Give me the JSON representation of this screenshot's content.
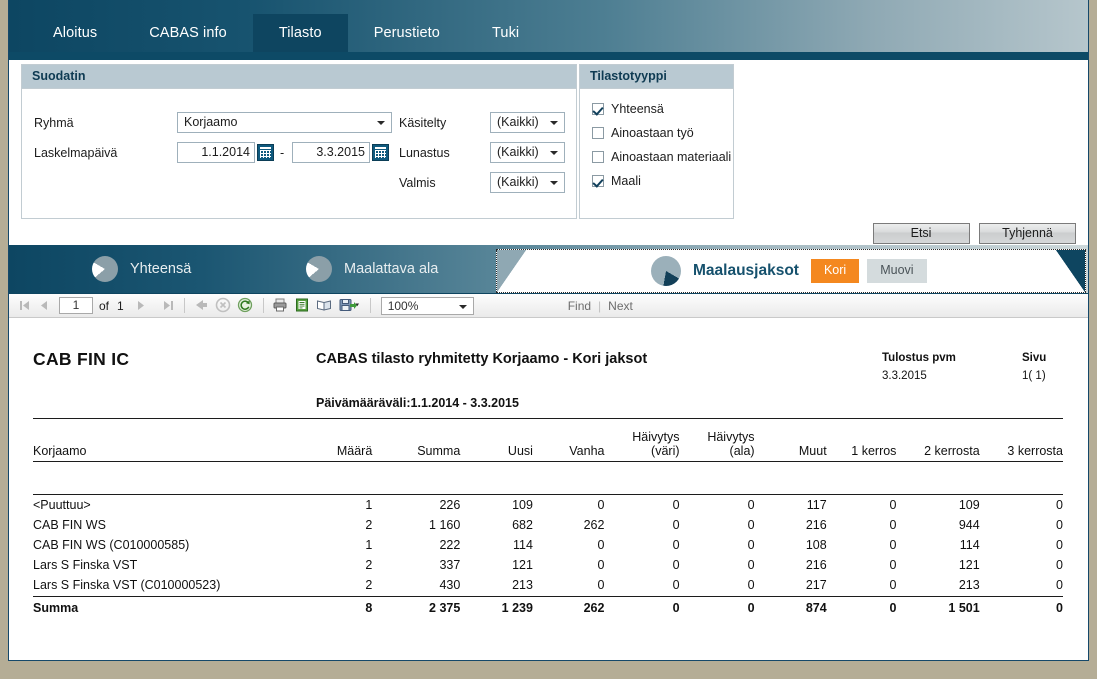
{
  "nav": {
    "tabs": [
      {
        "label": "Aloitus",
        "active": false
      },
      {
        "label": "CABAS info",
        "active": false
      },
      {
        "label": "Tilasto",
        "active": true
      },
      {
        "label": "Perustieto",
        "active": false
      },
      {
        "label": "Tuki",
        "active": false
      }
    ]
  },
  "filter": {
    "panel_title": "Suodatin",
    "ryhma_label": "Ryhmä",
    "ryhma_value": "Korjaamo",
    "laskelmapaiva_label": "Laskelmapäivä",
    "date_from": "1.1.2014",
    "date_to": "3.3.2015",
    "date_separator": "-",
    "kasitelty_label": "Käsitelty",
    "kasitelty_value": "(Kaikki)",
    "lunastus_label": "Lunastus",
    "lunastus_value": "(Kaikki)",
    "valmis_label": "Valmis",
    "valmis_value": "(Kaikki)",
    "search_button": "Etsi",
    "clear_button": "Tyhjennä"
  },
  "stattype": {
    "panel_title": "Tilastotyyppi",
    "options": [
      {
        "label": "Yhteensä",
        "checked": true
      },
      {
        "label": "Ainoastaan työ",
        "checked": false
      },
      {
        "label": "Ainoastaan materiaali",
        "checked": false
      },
      {
        "label": "Maali",
        "checked": true
      }
    ]
  },
  "category_tabs": {
    "inactive": [
      {
        "label": "Yhteensä",
        "icon": "pie-chart-icon"
      },
      {
        "label": "Maalattava ala",
        "icon": "pie-chart-icon"
      }
    ],
    "active": {
      "label": "Maalausjaksot",
      "icon": "pie-chart-icon",
      "pills": [
        {
          "label": "Kori",
          "selected": true
        },
        {
          "label": "Muovi",
          "selected": false
        }
      ],
      "selected_color": "#f4881f"
    }
  },
  "viewer_toolbar": {
    "page_current": "1",
    "of_label": "of",
    "page_total": "1",
    "zoom": "100%",
    "find_label": "Find",
    "next_label": "Next",
    "separator": "|",
    "icons": [
      "first-page-icon",
      "prev-page-icon",
      "next-page-icon",
      "last-page-icon",
      "back-icon",
      "stop-icon",
      "refresh-icon",
      "print-icon",
      "page-setup-icon",
      "print-layout-icon",
      "export-icon"
    ]
  },
  "report": {
    "logo": "CAB FIN IC",
    "title": "CABAS tilasto ryhmitetty Korjaamo - Kori jaksot",
    "date_range_line": "Päivämääräväli:1.1.2014 - 3.3.2015",
    "print_date_label": "Tulostus pvm",
    "print_date_value": "3.3.2015",
    "page_label": "Sivu",
    "page_value": "1( 1)",
    "columns": [
      "Korjaamo",
      "Määrä",
      "Summa",
      "Uusi",
      "Vanha",
      "Häivytys\n(väri)",
      "Häivytys\n(ala)",
      "Muut",
      "1 kerros",
      "2 kerrosta",
      "3 kerrosta"
    ],
    "rows": [
      {
        "cells": [
          "<Puuttuu>",
          "1",
          "226",
          "109",
          "0",
          "0",
          "0",
          "117",
          "0",
          "109",
          "0"
        ]
      },
      {
        "cells": [
          "CAB FIN WS",
          "2",
          "1 160",
          "682",
          "262",
          "0",
          "0",
          "216",
          "0",
          "944",
          "0"
        ]
      },
      {
        "cells": [
          "CAB FIN WS (C010000585)",
          "1",
          "222",
          "114",
          "0",
          "0",
          "0",
          "108",
          "0",
          "114",
          "0"
        ]
      },
      {
        "cells": [
          "Lars S Finska VST",
          "2",
          "337",
          "121",
          "0",
          "0",
          "0",
          "216",
          "0",
          "121",
          "0"
        ]
      },
      {
        "cells": [
          "Lars S Finska VST (C010000523)",
          "2",
          "430",
          "213",
          "0",
          "0",
          "0",
          "217",
          "0",
          "213",
          "0"
        ]
      }
    ],
    "total_row": {
      "cells": [
        "Summa",
        "8",
        "2 375",
        "1 239",
        "262",
        "0",
        "0",
        "874",
        "0",
        "1 501",
        "0"
      ]
    }
  }
}
